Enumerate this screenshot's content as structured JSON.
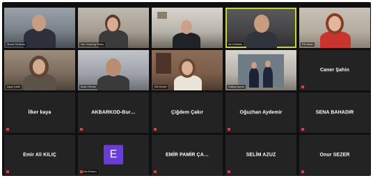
{
  "meeting": {
    "active_speaker_color": "#c8d62e",
    "avatar_color": "#6a3dd6",
    "tiles": [
      {
        "label": "Murat Özdemir",
        "type": "video"
      },
      {
        "label": "Nur Gündoğ Fidan",
        "type": "video"
      },
      {
        "label": "",
        "type": "video"
      },
      {
        "label": "Ali Gültekin",
        "type": "video",
        "active": true
      },
      {
        "label": "Elif Alkan",
        "type": "video"
      },
      {
        "label": "Ayşe Çelik",
        "type": "video"
      },
      {
        "label": "Bora Yılmaz",
        "type": "video"
      },
      {
        "label": "Elif Demir",
        "type": "video"
      },
      {
        "label": "Volkan Aydın",
        "type": "video"
      },
      {
        "label": "Caner Şahin",
        "type": "name"
      },
      {
        "label": "İlker kaya",
        "type": "name"
      },
      {
        "label": "AKBARKOD-Bur…",
        "type": "name"
      },
      {
        "label": "Çiğdem Çakır",
        "type": "name"
      },
      {
        "label": "Oğuzhan Aydemir",
        "type": "name"
      },
      {
        "label": "SENA BAHADIR",
        "type": "name"
      },
      {
        "label": "Emir Ali KILIÇ",
        "type": "name"
      },
      {
        "label": "Ela Erdem",
        "type": "avatar",
        "initial": "E"
      },
      {
        "label": "EMİR PAMİR ÇA…",
        "type": "name"
      },
      {
        "label": "SELİM AZUZ",
        "type": "name"
      },
      {
        "label": "Onur SEZER",
        "type": "name"
      }
    ]
  }
}
